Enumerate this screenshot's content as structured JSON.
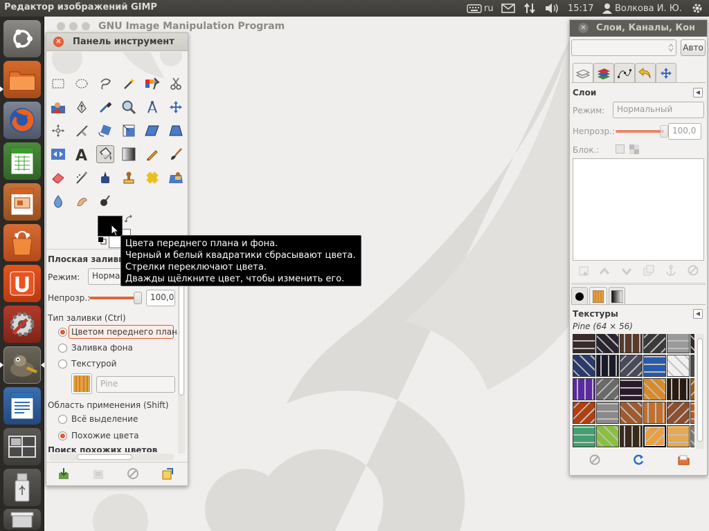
{
  "topbar": {
    "app_title": "Редактор изображений GIMP",
    "keyboard_layout": "ru",
    "time": "15:17",
    "user": "Волкова И. Ю."
  },
  "main_window": {
    "title": "GNU Image Manipulation Program"
  },
  "toolbox": {
    "title": "Панель инструмент",
    "tool_options": {
      "heading": "Плоская заливка",
      "mode_label": "Режим:",
      "mode_value": "Нормал",
      "opacity_label": "Непрозр.:",
      "opacity_value": "100,0",
      "opacity_fraction": 1.0,
      "fill_type_label": "Тип заливки (Ctrl)",
      "fill_options": [
        {
          "label": "Цветом переднего плана",
          "selected": true
        },
        {
          "label": "Заливка фона",
          "selected": false
        },
        {
          "label": "Текстурой",
          "selected": false
        }
      ],
      "pattern_name": "Pine",
      "area_label": "Область применения (Shift)",
      "area_options": [
        {
          "label": "Всё выделение",
          "selected": false
        },
        {
          "label": "Похожие цвета",
          "selected": true
        }
      ],
      "cut_label": "Поиск похожих цветов"
    },
    "tools": [
      "rect-select",
      "ellipse-select",
      "free-select",
      "fuzzy-select",
      "select-by-color",
      "scissors-select",
      "foreground-select",
      "paths",
      "color-picker",
      "zoom",
      "measure",
      "move",
      "alignment",
      "crop",
      "rotate",
      "scale",
      "shear",
      "perspective",
      "flip",
      "text",
      "bucket-fill",
      "blend",
      "pencil",
      "paintbrush",
      "eraser",
      "airbrush",
      "ink",
      "clone",
      "heal",
      "perspective-clone",
      "blur-sharpen",
      "smudge",
      "dodge-burn"
    ],
    "selected_tool": "bucket-fill",
    "colors": {
      "foreground": "#000000",
      "background": "#ffffff"
    }
  },
  "tooltip": {
    "lines": [
      "Цвета переднего плана и фона.",
      "Черный и белый квадратики сбрасывают цвета.",
      "Стрелки переключают цвета.",
      "Дважды щёлкните цвет, чтобы изменить его."
    ]
  },
  "layers_dock": {
    "title": "Слои, Каналы, Кон",
    "auto_button": "Авто",
    "layers_heading": "Слои",
    "mode_label": "Режим:",
    "mode_value": "Нормальный",
    "opacity_label": "Непрозр.:",
    "opacity_value": "100,0",
    "lock_label": "Блок.:",
    "textures_heading": "Текстуры",
    "selected_texture": "Pine (64 × 56)",
    "texture_colors": [
      [
        "#3a2a2a",
        "#2a2430",
        "#5a3a2a",
        "#3a3a3a",
        "#9a9a9a",
        "#3a2a2a"
      ],
      [
        "#2a3a6a",
        "#1a1a2a",
        "#4a4a5a",
        "#2a5aaa",
        "#f0f0f0",
        "#4a4a4a"
      ],
      [
        "#5a2aa0",
        "#6a6a6a",
        "#2a1a2a",
        "#d88a2a",
        "#2a1a10",
        "#a05a10"
      ],
      [
        "#b04010",
        "#8a8a8a",
        "#a05a30",
        "#c07030",
        "#8a5030",
        "#c05a20"
      ],
      [
        "#40a070",
        "#8ac040",
        "#3a2a1a",
        "#e8a040",
        "#e8a850",
        "#7a8070"
      ],
      [
        "#e8c8c0",
        "#000000",
        "#6a8ad0",
        "#70b030",
        "#8040b0",
        "#b0a0b0"
      ]
    ]
  }
}
